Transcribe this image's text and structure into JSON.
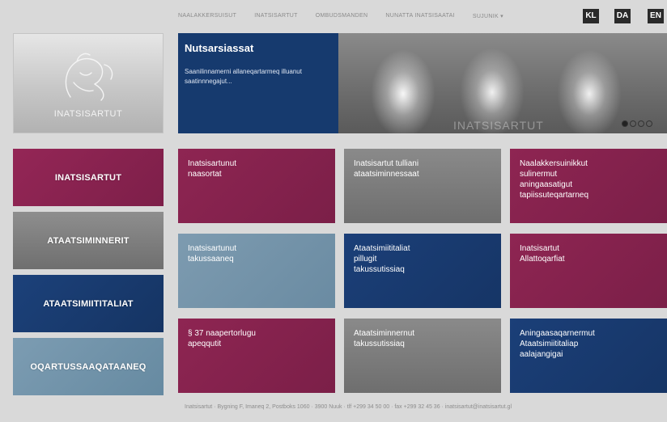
{
  "nav": {
    "links": [
      "NAALAKKERSUISUT",
      "INATSISARTUT",
      "OMBUDSMANDEN",
      "NUNATTA INATSISAATAI",
      "SUJUNIK"
    ],
    "more_icon": "caret-down-icon"
  },
  "languages": [
    "KL",
    "DA",
    "EN"
  ],
  "logo": {
    "text": "INATSISARTUT",
    "icon": "polar-bear-emblem"
  },
  "banner": {
    "title": "Nutsarsiassat",
    "text": "Saanilinnamerni allaneqartarmeq illuanut saatinnnegajut...",
    "watermark": "INATSISARTUT",
    "slides": 4,
    "active_slide": 1
  },
  "sidebar": {
    "items": [
      {
        "label": "INATSISARTUT",
        "color": "#8a2250"
      },
      {
        "label": "ATAATSIMINNERIT",
        "color": "#7a7a7a"
      },
      {
        "label": "ATAATSIMIITITALIAT",
        "color": "#173b70"
      },
      {
        "label": "OQARTUSSAAQATAANEQ",
        "color": "#6f92a8"
      }
    ]
  },
  "tiles": [
    {
      "label": "Inatsisartunut\nnaasortat",
      "style": "maroon"
    },
    {
      "label": "Inatsisartut tulliani\nataatsiminnessaat",
      "style": "gray"
    },
    {
      "label": "Naalakkersuinikkut\nsulinermut\naningaasatigut\ntapiissuteqartarneq",
      "style": "maroon"
    },
    {
      "label": "Inatsisartunut\ntakussaaneq",
      "style": "steel"
    },
    {
      "label": "Ataatsimiititaliat\npillugit\ntakussutissiaq",
      "style": "navy"
    },
    {
      "label": "Inatsisartut\nAllattoqarfiat",
      "style": "maroon"
    },
    {
      "label": "§ 37 naapertorlugu\napeqqutit",
      "style": "maroon"
    },
    {
      "label": "Ataatsiminnernut\ntakussutissiaq",
      "style": "gray"
    },
    {
      "label": "Aningaasaqarnermut\nAtaatsimiititaliap\naalajangigai",
      "style": "navy"
    }
  ],
  "footer": {
    "text": "Inatsisartut · Bygning F, Imaneq 2, Postboks 1060 · 3900 Nuuk · tlf +299 34 50 00 · fax +299 32 45 36 · inatsisartut@inatsisartut.gl"
  }
}
